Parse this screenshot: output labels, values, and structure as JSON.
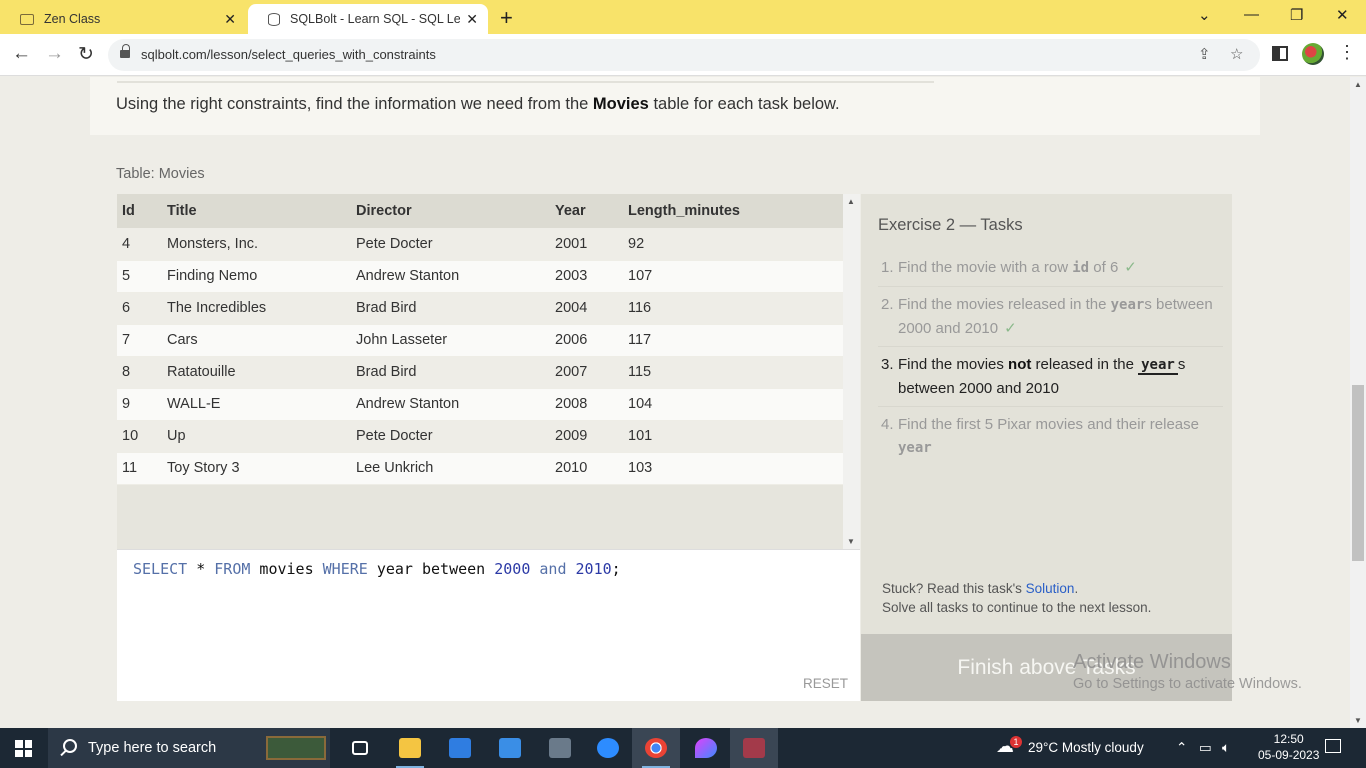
{
  "browser": {
    "tabs": [
      {
        "label": "Zen Class",
        "active": false
      },
      {
        "label": "SQLBolt - Learn SQL - SQL Lesson",
        "active": true
      }
    ],
    "url": "sqlbolt.com/lesson/select_queries_with_constraints"
  },
  "lesson": {
    "intro_pre": "Using the right constraints, find the information we need from the ",
    "intro_bold": "Movies",
    "intro_post": " table for each task below."
  },
  "table": {
    "caption": "Table: Movies",
    "columns": [
      "Id",
      "Title",
      "Director",
      "Year",
      "Length_minutes"
    ],
    "rows": [
      [
        "4",
        "Monsters, Inc.",
        "Pete Docter",
        "2001",
        "92"
      ],
      [
        "5",
        "Finding Nemo",
        "Andrew Stanton",
        "2003",
        "107"
      ],
      [
        "6",
        "The Incredibles",
        "Brad Bird",
        "2004",
        "116"
      ],
      [
        "7",
        "Cars",
        "John Lasseter",
        "2006",
        "117"
      ],
      [
        "8",
        "Ratatouille",
        "Brad Bird",
        "2007",
        "115"
      ],
      [
        "9",
        "WALL-E",
        "Andrew Stanton",
        "2008",
        "104"
      ],
      [
        "10",
        "Up",
        "Pete Docter",
        "2009",
        "101"
      ],
      [
        "11",
        "Toy Story 3",
        "Lee Unkrich",
        "2010",
        "103"
      ]
    ]
  },
  "editor": {
    "tokens": [
      {
        "t": "SELECT",
        "k": "kw"
      },
      {
        "t": " * ",
        "k": ""
      },
      {
        "t": "FROM",
        "k": "kw"
      },
      {
        "t": " movies ",
        "k": ""
      },
      {
        "t": "WHERE",
        "k": "kw"
      },
      {
        "t": " year between ",
        "k": ""
      },
      {
        "t": "2000",
        "k": "num"
      },
      {
        "t": " ",
        "k": ""
      },
      {
        "t": "and",
        "k": "kw"
      },
      {
        "t": " ",
        "k": ""
      },
      {
        "t": "2010",
        "k": "num"
      },
      {
        "t": ";",
        "k": ""
      }
    ],
    "reset_label": "RESET"
  },
  "tasks": {
    "title": "Exercise 2 — Tasks",
    "items": [
      {
        "num": "1.",
        "pre": "Find the movie with a row ",
        "code": "id",
        "post": " of 6",
        "done": true,
        "active": false
      },
      {
        "num": "2.",
        "pre": "Find the movies released in the ",
        "code": "year",
        "post": "s between 2000 and 2010",
        "done": true,
        "active": false
      },
      {
        "num": "3.",
        "pre": "Find the movies ",
        "bold": "not",
        "mid": " released in the ",
        "code": "year",
        "post": "s between 2000 and 2010",
        "done": false,
        "active": true
      },
      {
        "num": "4.",
        "pre": "Find the first 5 Pixar movies and their release ",
        "code": "year",
        "post": "",
        "done": false,
        "active": false
      }
    ],
    "check_mark": "✓",
    "stuck_text": "Stuck? Read this task's ",
    "solution_link": "Solution",
    "stuck_end": ".",
    "continue_text": "Solve all tasks to continue to the next lesson.",
    "finish_label": "Finish above Tasks"
  },
  "watermark": {
    "title": "Activate Windows",
    "subtitle": "Go to Settings to activate Windows."
  },
  "taskbar": {
    "search_placeholder": "Type here to search",
    "weather": "29°C  Mostly cloudy",
    "weather_badge": "1",
    "time": "12:50",
    "date": "05-09-2023"
  }
}
